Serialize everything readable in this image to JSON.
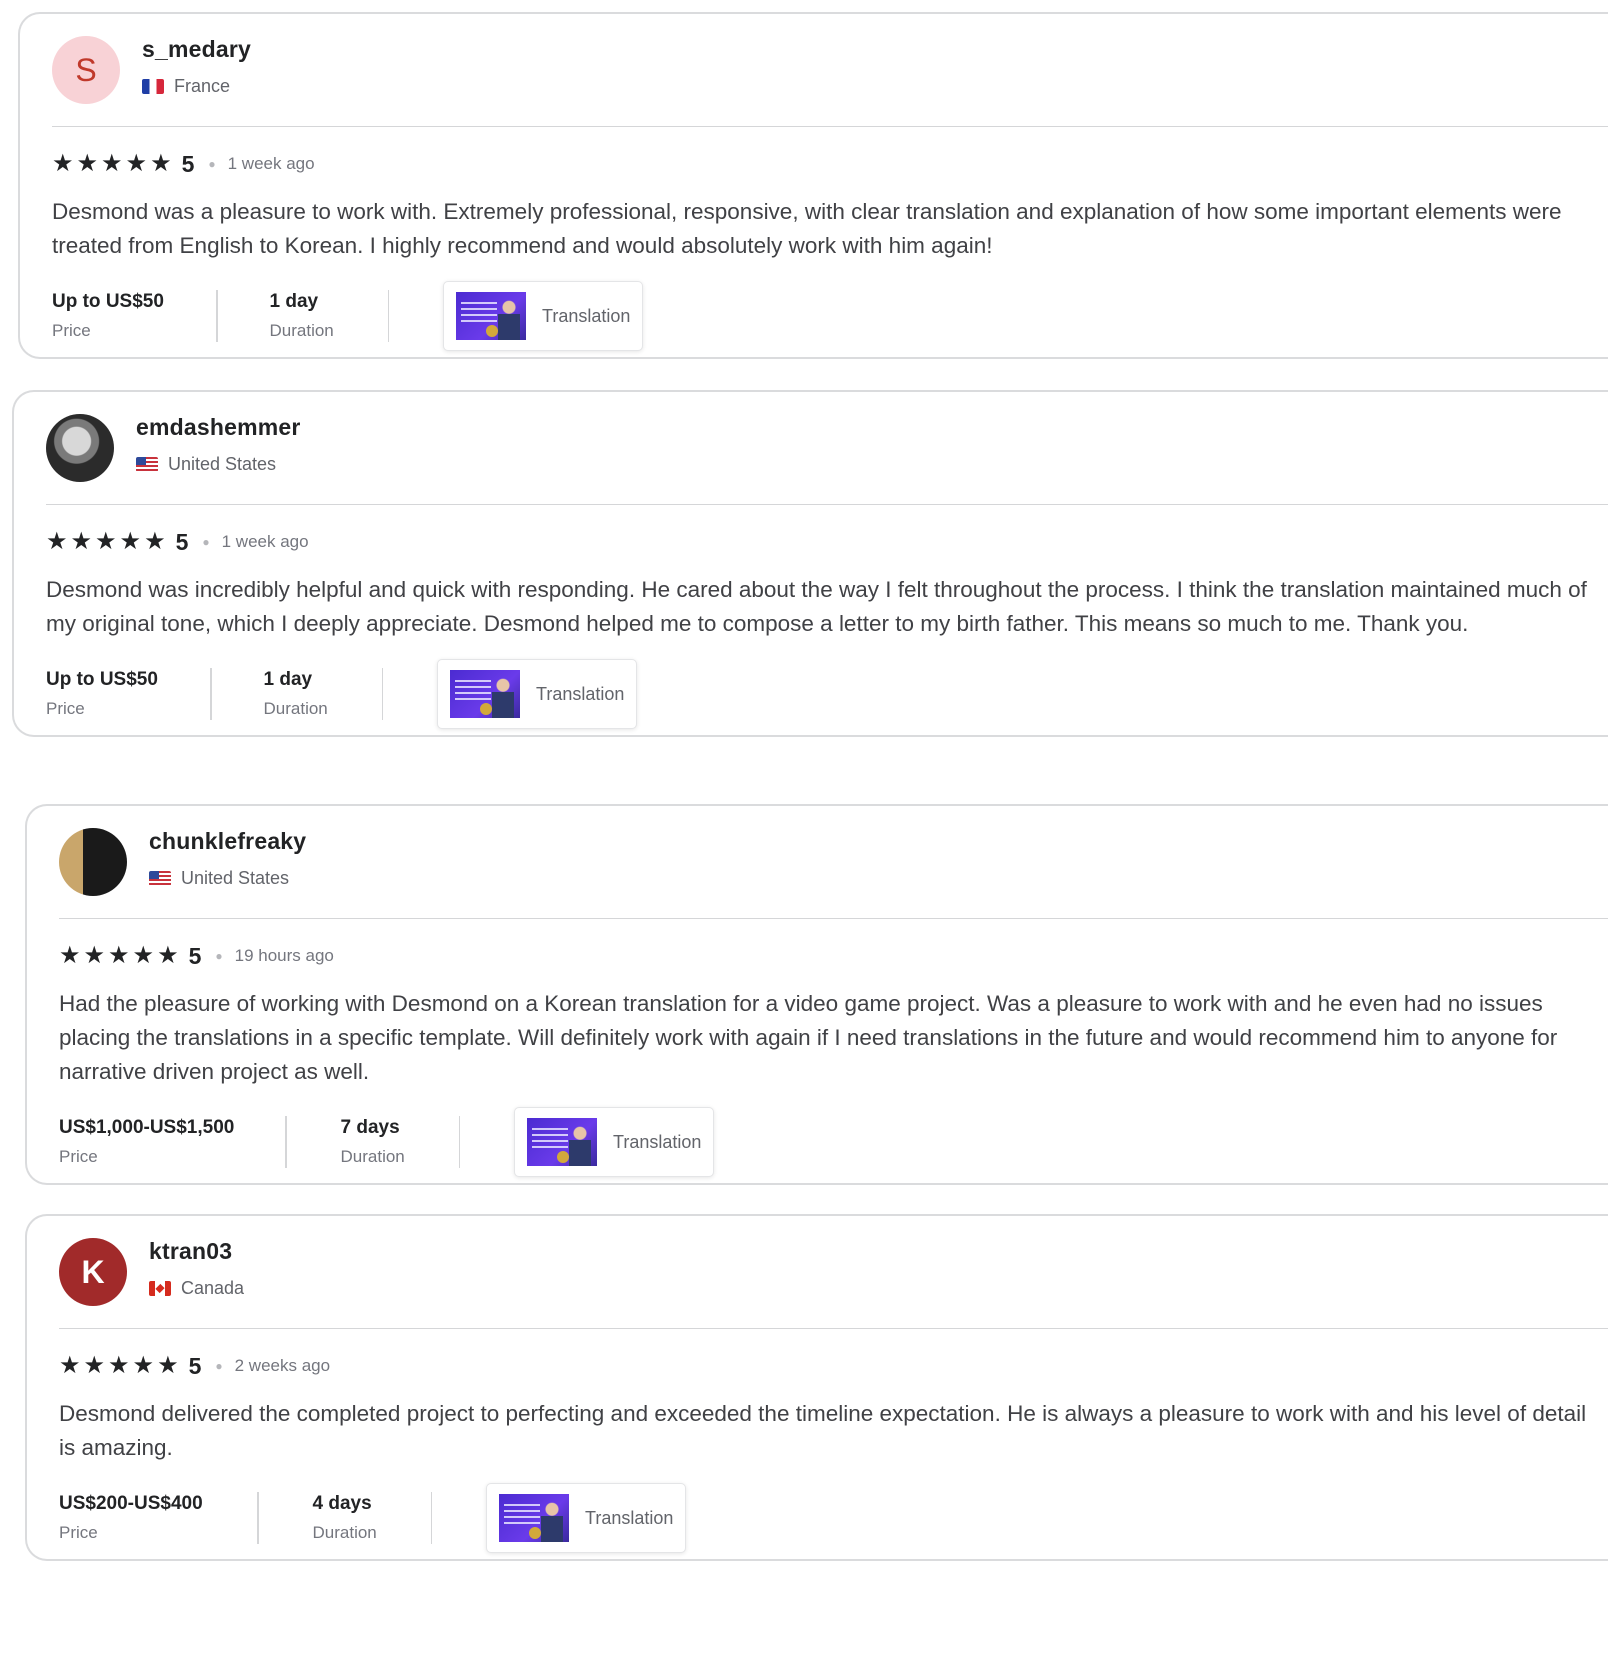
{
  "reviews": [
    {
      "avatar_letter": "S",
      "username": "s_medary",
      "country": "France",
      "flag_icon": "france-flag-icon",
      "rating": "5",
      "stars": 5,
      "time": "1 week ago",
      "text": "Desmond was a pleasure to work with. Extremely professional, responsive, with clear translation and explanation of how some important elements were treated from English to Korean. I highly recommend and would absolutely work with him again!",
      "price_value": "Up to US$50",
      "price_label": "Price",
      "duration_value": "1 day",
      "duration_label": "Duration",
      "gig_label": "Translation"
    },
    {
      "avatar_letter": "",
      "username": "emdashemmer",
      "country": "United States",
      "flag_icon": "us-flag-icon",
      "rating": "5",
      "stars": 5,
      "time": "1 week ago",
      "text": "Desmond was incredibly helpful and quick with responding. He cared about the way I felt throughout the process. I think the translation maintained much of my original tone, which I deeply appreciate. Desmond helped me to compose a letter to my birth father. This means so much to me. Thank you.",
      "price_value": "Up to US$50",
      "price_label": "Price",
      "duration_value": "1 day",
      "duration_label": "Duration",
      "gig_label": "Translation"
    },
    {
      "avatar_letter": "",
      "username": "chunklefreaky",
      "country": "United States",
      "flag_icon": "us-flag-icon",
      "rating": "5",
      "stars": 5,
      "time": "19 hours ago",
      "text": "Had the pleasure of working with Desmond on a Korean translation for a video game project. Was a pleasure to work with and he even had no issues placing the translations in a specific template. Will definitely work with again if I need translations in the future and would recommend him to anyone for narrative driven project as well.",
      "price_value": "US$1,000-US$1,500",
      "price_label": "Price",
      "duration_value": "7 days",
      "duration_label": "Duration",
      "gig_label": "Translation"
    },
    {
      "avatar_letter": "K",
      "username": "ktran03",
      "country": "Canada",
      "flag_icon": "canada-flag-icon",
      "rating": "5",
      "stars": 5,
      "time": "2 weeks ago",
      "text": "Desmond delivered the completed project to perfecting and exceeded the timeline expectation. He is always a pleasure to work with and his level of detail is amazing.",
      "price_value": "US$200-US$400",
      "price_label": "Price",
      "duration_value": "4 days",
      "duration_label": "Duration",
      "gig_label": "Translation"
    }
  ],
  "icons": {
    "star": "star-icon",
    "dot": "separator-dot"
  }
}
